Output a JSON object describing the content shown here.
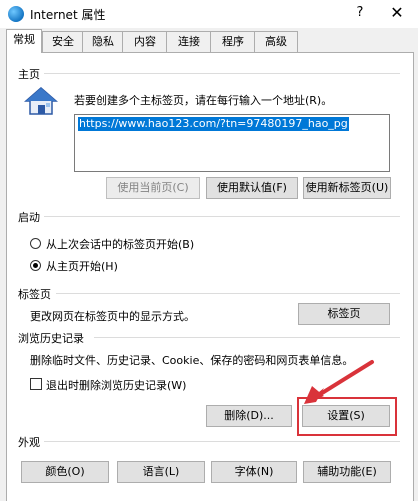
{
  "window": {
    "title": "Internet 属性",
    "help": "?",
    "close": "✕"
  },
  "tabs": [
    "常规",
    "安全",
    "隐私",
    "内容",
    "连接",
    "程序",
    "高级"
  ],
  "home": {
    "section": "主页",
    "instruction": "若要创建多个主标签页，请在每行输入一个地址(R)。",
    "url": "https://www.hao123.com/?tn=97480197_hao_pg",
    "use_current": "使用当前页(C)",
    "use_default": "使用默认值(F)",
    "use_new_tab": "使用新标签页(U)"
  },
  "startup": {
    "section": "启动",
    "option_last_session": "从上次会话中的标签页开始(B)",
    "option_home": "从主页开始(H)",
    "selected": "option_home"
  },
  "tabs_section": {
    "section": "标签页",
    "description": "更改网页在标签页中的显示方式。",
    "button": "标签页"
  },
  "history": {
    "section": "浏览历史记录",
    "description": "删除临时文件、历史记录、Cookie、保存的密码和网页表单信息。",
    "checkbox_label": "退出时删除浏览历史记录(W)",
    "checkbox_checked": false,
    "delete_button": "删除(D)...",
    "settings_button": "设置(S)"
  },
  "appearance": {
    "section": "外观",
    "colors": "颜色(O)",
    "languages": "语言(L)",
    "fonts": "字体(N)",
    "accessibility": "辅助功能(E)"
  },
  "colors": {
    "highlight": "#d9333a",
    "selection": "#0078d7"
  }
}
